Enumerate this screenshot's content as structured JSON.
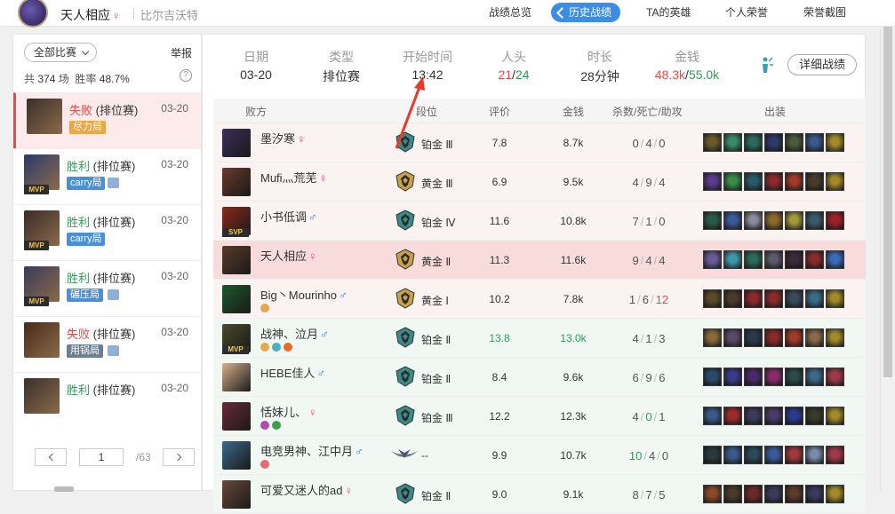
{
  "header": {
    "username": "天人相应",
    "gender_symbol": "♀",
    "server": "比尔吉沃特",
    "nav": [
      {
        "label": "战绩总览",
        "active": false
      },
      {
        "label": "历史战绩",
        "active": true
      },
      {
        "label": "TA的英雄",
        "active": false
      },
      {
        "label": "个人荣誉",
        "active": false
      },
      {
        "label": "荣誉截图",
        "active": false
      }
    ]
  },
  "sidebar": {
    "filter": "全部比赛",
    "report": "举报",
    "stats_total_prefix": "共",
    "stats_total": "374",
    "stats_total_suffix": "场",
    "winrate_label": "胜率",
    "winrate": "48.7%",
    "help": "?",
    "games": [
      {
        "result": "失败",
        "type": "(排位赛)",
        "date": "03-20",
        "tag": "尽力局",
        "tag_color": "#e8a84a",
        "mvp": false,
        "img": false,
        "win": false
      },
      {
        "result": "胜利",
        "type": "(排位赛)",
        "date": "03-20",
        "tag": "carry局",
        "tag_color": "#4a90d9",
        "mvp": true,
        "img": true,
        "win": true
      },
      {
        "result": "胜利",
        "type": "(排位赛)",
        "date": "03-20",
        "tag": "carry局",
        "tag_color": "#4a90d9",
        "mvp": true,
        "img": false,
        "win": true
      },
      {
        "result": "胜利",
        "type": "(排位赛)",
        "date": "03-20",
        "tag": "碾压局",
        "tag_color": "#4a90d9",
        "mvp": true,
        "img": true,
        "win": true
      },
      {
        "result": "失败",
        "type": "(排位赛)",
        "date": "03-20",
        "tag": "用锅局",
        "tag_color": "#6e7f93",
        "mvp": false,
        "img": true,
        "win": false
      },
      {
        "result": "胜利",
        "type": "(排位赛)",
        "date": "03-20",
        "tag": "",
        "tag_color": "",
        "mvp": false,
        "img": false,
        "win": true
      }
    ],
    "pager": {
      "current": "1",
      "total": "/63"
    }
  },
  "summary": {
    "date_label": "日期",
    "date": "03-20",
    "type_label": "类型",
    "type": "排位赛",
    "start_label": "开始时间",
    "start": "13:42",
    "kills_label": "人头",
    "kills_a": "21",
    "kills_sep": "/",
    "kills_b": "24",
    "duration_label": "时长",
    "duration": "28分钟",
    "gold_label": "金钱",
    "gold_a": "48.3k",
    "gold_sep": "/",
    "gold_b": "55.0k",
    "detail_button": "详细战绩"
  },
  "table": {
    "headers": {
      "team": "败方",
      "rank": "段位",
      "score": "评价",
      "gold": "金钱",
      "kda": "杀数/死亡/助攻",
      "items": "出装"
    },
    "rows": [
      {
        "name": "墨汐寒",
        "gender": "♀",
        "rank": "铂金 Ⅲ",
        "rank_tier": "plat",
        "score": "7.8",
        "score_hl": false,
        "gold": "8.7k",
        "gold_hl": false,
        "k": "0",
        "d": "4",
        "a": "0",
        "k_c": "",
        "d_c": "",
        "a_c": "",
        "team": "lose",
        "me": false,
        "mvp": "",
        "badges": [],
        "hero_color": "#3a2f5a"
      },
      {
        "name": "Mufi灬荒芜",
        "gender": "♀",
        "rank": "黄金 Ⅲ",
        "rank_tier": "gold",
        "score": "6.9",
        "score_hl": false,
        "gold": "9.5k",
        "gold_hl": false,
        "k": "4",
        "d": "9",
        "a": "4",
        "k_c": "",
        "d_c": "",
        "a_c": "",
        "team": "lose",
        "me": false,
        "mvp": "",
        "badges": [],
        "hero_color": "#6a3a2a"
      },
      {
        "name": "小书低调",
        "gender": "♂",
        "rank": "铂金 Ⅳ",
        "rank_tier": "plat",
        "score": "11.6",
        "score_hl": false,
        "gold": "10.8k",
        "gold_hl": false,
        "k": "7",
        "d": "1",
        "a": "0",
        "k_c": "",
        "d_c": "",
        "a_c": "",
        "team": "lose",
        "me": false,
        "mvp": "SVP",
        "badges": [],
        "hero_color": "#8a2a1a"
      },
      {
        "name": "天人相应",
        "gender": "♀",
        "rank": "黄金 Ⅱ",
        "rank_tier": "gold",
        "score": "11.3",
        "score_hl": false,
        "gold": "11.6k",
        "gold_hl": false,
        "k": "9",
        "d": "4",
        "a": "4",
        "k_c": "",
        "d_c": "",
        "a_c": "",
        "team": "lose",
        "me": true,
        "mvp": "",
        "badges": [],
        "hero_color": "#5a3a2a"
      },
      {
        "name": "Big丶Mourinho",
        "gender": "♂",
        "rank": "黄金 Ⅰ",
        "rank_tier": "gold",
        "score": "10.2",
        "score_hl": false,
        "gold": "7.8k",
        "gold_hl": false,
        "k": "1",
        "d": "6",
        "a": "12",
        "k_c": "",
        "d_c": "",
        "a_c": "red",
        "team": "lose",
        "me": false,
        "mvp": "",
        "badges": [
          "#e8a84a"
        ],
        "hero_color": "#1a5a2a"
      },
      {
        "name": "战神、泣月",
        "gender": "♂",
        "rank": "铂金 Ⅱ",
        "rank_tier": "plat",
        "score": "13.8",
        "score_hl": true,
        "gold": "13.0k",
        "gold_hl": true,
        "k": "4",
        "d": "1",
        "a": "3",
        "k_c": "",
        "d_c": "",
        "a_c": "",
        "team": "win",
        "me": false,
        "mvp": "MVP",
        "badges": [
          "#e8a84a",
          "#4ab0c0",
          "#e86a2a"
        ],
        "hero_color": "#4a4a2a"
      },
      {
        "name": "HEBE佳人",
        "gender": "♂",
        "rank": "铂金 Ⅱ",
        "rank_tier": "plat",
        "score": "8.4",
        "score_hl": false,
        "gold": "9.6k",
        "gold_hl": false,
        "k": "6",
        "d": "9",
        "a": "6",
        "k_c": "",
        "d_c": "",
        "a_c": "",
        "team": "win",
        "me": false,
        "mvp": "",
        "badges": [],
        "hero_color": "#d8b090"
      },
      {
        "name": "恬妹儿、",
        "gender": "♀",
        "rank": "铂金 Ⅲ",
        "rank_tier": "plat",
        "score": "12.2",
        "score_hl": false,
        "gold": "12.3k",
        "gold_hl": false,
        "k": "4",
        "d": "0",
        "a": "1",
        "k_c": "",
        "d_c": "green",
        "a_c": "",
        "team": "win",
        "me": false,
        "mvp": "",
        "badges": [
          "#b04ab0",
          "#3aa04a"
        ],
        "hero_color": "#6a2a3a"
      },
      {
        "name": "电竞男神、江中月",
        "gender": "♂",
        "rank": "--",
        "rank_tier": "none",
        "score": "9.9",
        "score_hl": false,
        "gold": "10.7k",
        "gold_hl": false,
        "k": "10",
        "d": "4",
        "a": "0",
        "k_c": "green",
        "d_c": "",
        "a_c": "",
        "team": "win",
        "me": false,
        "mvp": "",
        "badges": [
          "#e86a6a"
        ],
        "hero_color": "#3a6a8a"
      },
      {
        "name": "可爱又迷人的ad",
        "gender": "♀",
        "rank": "铂金 Ⅱ",
        "rank_tier": "plat",
        "score": "9.0",
        "score_hl": false,
        "gold": "9.1k",
        "gold_hl": false,
        "k": "8",
        "d": "7",
        "a": "5",
        "k_c": "",
        "d_c": "",
        "a_c": "",
        "team": "win",
        "me": false,
        "mvp": "",
        "badges": [],
        "hero_color": "#6a4a3a"
      }
    ]
  },
  "colors": {
    "accent": "#3a8ee6",
    "lose": "#e94a4a",
    "win": "#2e9a5a",
    "arrow": "#e63a2a"
  }
}
